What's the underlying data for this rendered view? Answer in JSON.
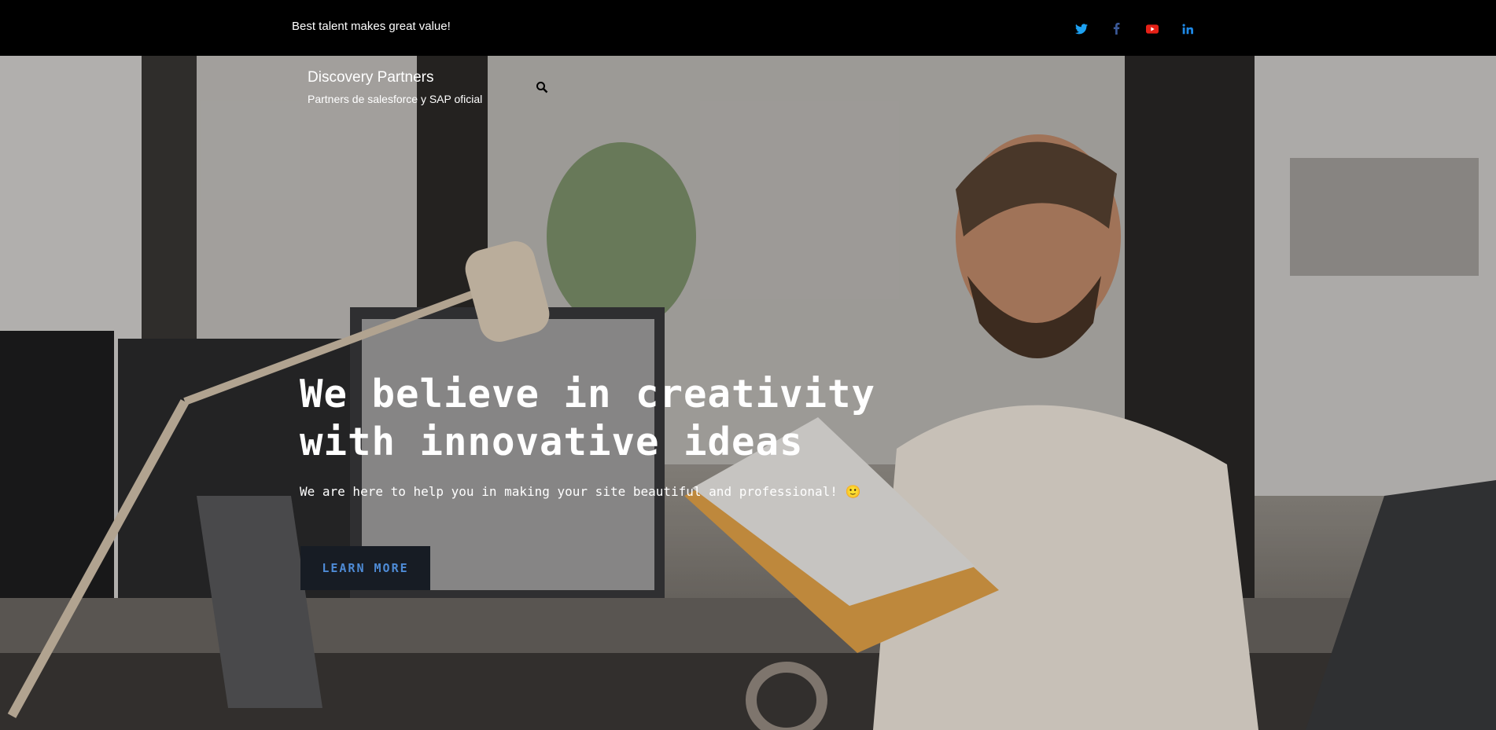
{
  "topbar": {
    "tagline": "Best talent makes great value!",
    "socials": [
      {
        "icon": "twitter-icon",
        "color": "#1da1f2"
      },
      {
        "icon": "facebook-icon",
        "color": "#3b5998"
      },
      {
        "icon": "youtube-icon",
        "color": "#e62117"
      },
      {
        "icon": "linkedin-icon",
        "color": "#1e88e5"
      }
    ]
  },
  "brand": {
    "title": "Discovery Partners",
    "subtitle": "Partners de salesforce y SAP oficial"
  },
  "hero": {
    "headline_line1": "We believe in creativity",
    "headline_line2": "with innovative ideas",
    "subline": "We are here to help you in making your site beautiful and professional! 🙂",
    "cta_label": "LEARN MORE"
  },
  "colors": {
    "topbar_bg": "#000000",
    "cta_bg": "#171c24",
    "cta_text": "#4e8bd6"
  }
}
